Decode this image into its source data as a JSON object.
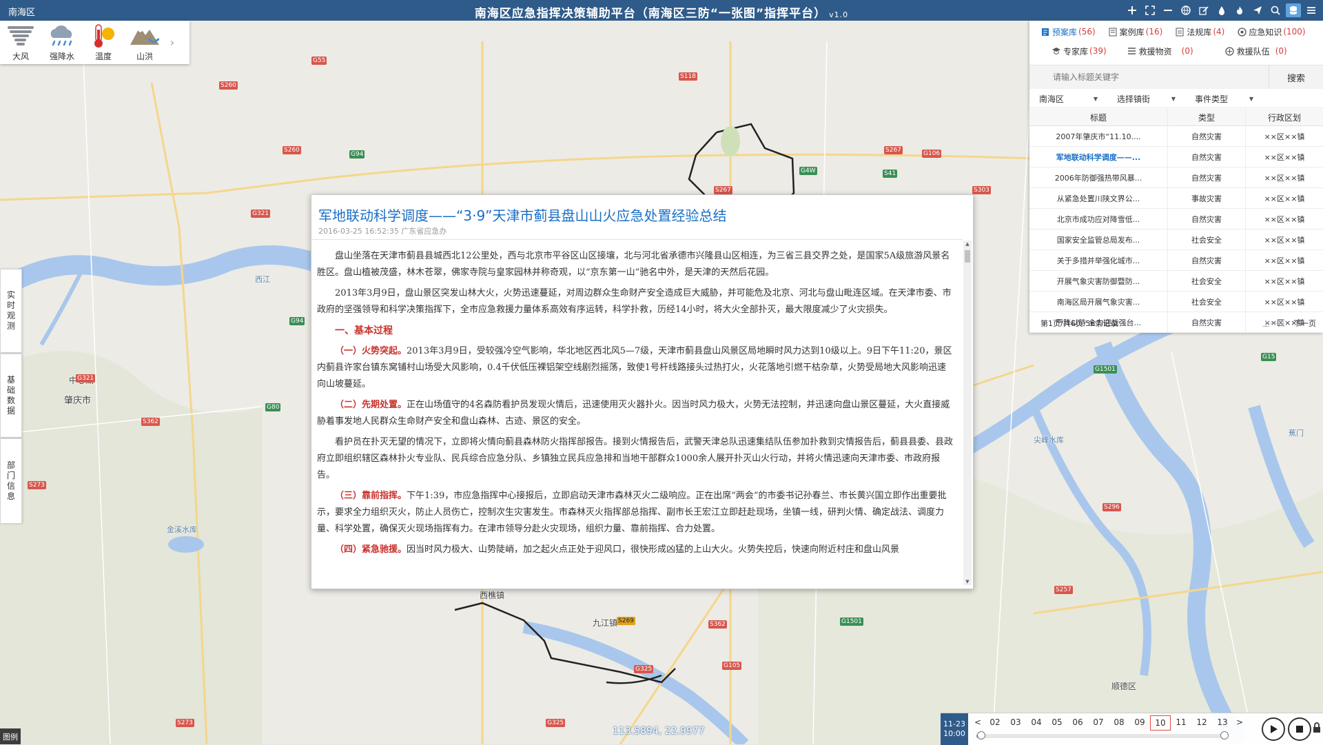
{
  "header": {
    "region": "南海区",
    "title": "南海区应急指挥决策辅助平台（南海区三防“一张图”指挥平台）",
    "version": "v1.0",
    "icons": [
      "plus-icon",
      "fullscreen-icon",
      "minus-icon",
      "globe-icon",
      "edit-icon",
      "drop-icon",
      "fire-icon",
      "send-icon",
      "search-icon",
      "database-icon",
      "menu-icon"
    ]
  },
  "weather_layers": [
    {
      "label": "大风",
      "icon": "tornado-icon"
    },
    {
      "label": "强降水",
      "icon": "rain-cloud-icon"
    },
    {
      "label": "温度",
      "icon": "thermometer-icon"
    },
    {
      "label": "山洪",
      "icon": "mountain-flood-icon"
    }
  ],
  "side_tabs": [
    "实时观测",
    "基础数据",
    "部门信息"
  ],
  "legend_label": "图例",
  "libraries": {
    "row1": [
      {
        "label": "预案库",
        "count": "(56)",
        "active": true,
        "icon": "plan-icon"
      },
      {
        "label": "案例库",
        "count": "(16)",
        "icon": "case-icon"
      },
      {
        "label": "法规库",
        "count": "(4)",
        "icon": "law-icon"
      },
      {
        "label": "应急知识",
        "count": "(100)",
        "icon": "knowledge-icon"
      }
    ],
    "row2": [
      {
        "label": "专家库",
        "count": "(39)",
        "icon": "expert-icon"
      },
      {
        "label": "救援物资",
        "count": "(0)",
        "icon": "supplies-icon"
      },
      {
        "label": "救援队伍",
        "count": "(0)",
        "icon": "team-icon"
      }
    ]
  },
  "search": {
    "placeholder": "请输入标题关键字",
    "button": "搜索"
  },
  "filters": [
    "南海区",
    "选择镇街",
    "事件类型"
  ],
  "table": {
    "headers": [
      "标题",
      "类型",
      "行政区划"
    ],
    "rows": [
      {
        "title": "2007年肇庆市“11.10....",
        "type": "自然灾害",
        "region": "××区××镇"
      },
      {
        "title": "军地联动科学调度——...",
        "type": "自然灾害",
        "region": "××区××镇",
        "selected": true
      },
      {
        "title": "2006年防御强热带风暴...",
        "type": "自然灾害",
        "region": "××区××镇"
      },
      {
        "title": "从紧急处置川陕文界公...",
        "type": "事故灾害",
        "region": "××区××镇"
      },
      {
        "title": "北京市成功应对降雪低...",
        "type": "自然灾害",
        "region": "××区××镇"
      },
      {
        "title": "国家安全监管总局发布...",
        "type": "社会安全",
        "region": "××区××镇"
      },
      {
        "title": "关于多措并举强化城市...",
        "type": "自然灾害",
        "region": "××区××镇"
      },
      {
        "title": "开展气象灾害防御暨防...",
        "type": "社会安全",
        "region": "××区××镇"
      },
      {
        "title": "南海区局开展气象灾害...",
        "type": "社会安全",
        "region": "××区××镇"
      },
      {
        "title": "严阵以待 全力迎战强台...",
        "type": "自然灾害",
        "region": "××区××镇"
      }
    ],
    "pager": {
      "info": "第1页/共6页 56条记录",
      "prev": "上一页",
      "next": "下一页"
    }
  },
  "article": {
    "title": "军地联动科学调度——“3·9”天津市蓟县盘山山火应急处置经验总结",
    "meta": "2016-03-25 16:52:35 广东省应急办",
    "p1": "盘山坐落在天津市蓟县县城西北12公里处，西与北京市平谷区山区接壤，北与河北省承德市兴隆县山区相连，为三省三县交界之处，是国家5A级旅游风景名胜区。盘山植被茂盛，林木苍翠，佛家寺院与皇家园林并称奇观，以“京东第一山”驰名中外，是天津的天然后花园。",
    "p2": "2013年3月9日，盘山景区突发山林大火，火势迅速蔓延，对周边群众生命财产安全造成巨大威胁，并可能危及北京、河北与盘山毗连区域。在天津市委、市政府的坚强领导和科学决策指挥下，全市应急救援力量体系高效有序运转，科学扑救，历经14小时，将大火全部扑灭，最大限度减少了火灾损失。",
    "h1": "一、基本过程",
    "s1_head": "（一）火势突起。",
    "s1": "2013年3月9日，受较强冷空气影响，华北地区西北风5—7级，天津市蓟县盘山风景区局地瞬时风力达到10级以上。9日下午11:20，景区内蓟县许家台镇东窝铺村山场受大风影响，0.4千伏低压裸铝架空线剧烈摇荡，致使1号杆线路接头过热打火，火花落地引燃干枯杂草，火势受局地大风影响迅速向山坡蔓延。",
    "s2_head": "（二）先期处置。",
    "s2": "正在山场值守的4名森防看护员发现火情后，迅速使用灭火器扑火。因当时风力极大，火势无法控制，并迅速向盘山景区蔓延，大火直接威胁着事发地人民群众生命财产安全和盘山森林、古迹、景区的安全。",
    "p3": "看护员在扑灭无望的情况下，立即将火情向蓟县森林防火指挥部报告。接到火情报告后，武警天津总队迅速集结队伍参加扑救到灾情报告后，蓟县县委、县政府立即组织辖区森林扑火专业队、民兵综合应急分队、乡镇独立民兵应急排和当地干部群众1000余人展开扑灭山火行动，并将火情迅速向天津市委、市政府报告。",
    "s3_head": "（三）靠前指挥。",
    "s3": "下午1:39，市应急指挥中心接报后，立即启动天津市森林灭火二级响应。正在出席“两会”的市委书记孙春兰、市长黄兴国立即作出重要批示，要求全力组织灭火，防止人员伤亡，控制次生灾害发生。市森林灭火指挥部总指挥、副市长王宏江立即赶赴现场，坐镇一线，研判火情、确定战法、调度力量、科学处置，确保灭火现场指挥有力。在津市领导分赴火灾现场，组织力量、靠前指挥、合力处置。",
    "s4_head": "（四）紧急驰援。",
    "s4": "因当时风力极大、山势陡峭，加之起火点正处于迎风口，很快形成凶猛的上山大火。火势失控后，快速向附近村庄和盘山风景"
  },
  "map": {
    "places": [
      "肇庆市",
      "中心湖",
      "西樵镇",
      "九江镇",
      "顺德区",
      "金溪水库",
      "尖峰水库",
      "西江",
      "蕉门"
    ],
    "coords": "113.5894, 22.9977"
  },
  "timeline": {
    "date": "11-23",
    "time": "10:00",
    "hours": [
      "<",
      "02",
      "03",
      "04",
      "05",
      "06",
      "07",
      "08",
      "09",
      "10",
      "11",
      "12",
      "13",
      ">"
    ],
    "current_hour": "10",
    "progress": 0.02
  }
}
